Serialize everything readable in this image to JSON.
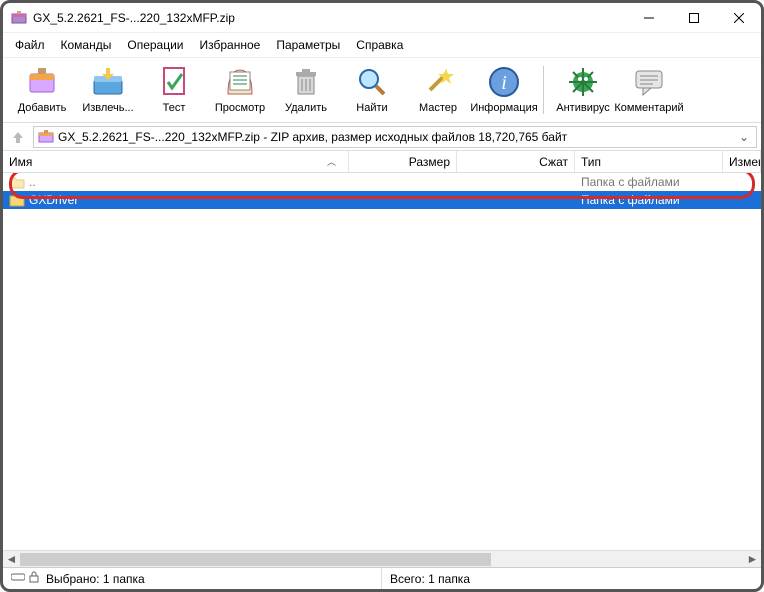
{
  "window": {
    "title": "GX_5.2.2621_FS-...220_132xMFP.zip"
  },
  "menu": {
    "file": "Файл",
    "commands": "Команды",
    "operations": "Операции",
    "favorites": "Избранное",
    "options": "Параметры",
    "help": "Справка"
  },
  "toolbar": {
    "add": "Добавить",
    "extract": "Извлечь...",
    "test": "Тест",
    "view": "Просмотр",
    "delete": "Удалить",
    "find": "Найти",
    "wizard": "Мастер",
    "info": "Информация",
    "antivirus": "Антивирус",
    "comment": "Комментарий"
  },
  "address": {
    "text": "GX_5.2.2621_FS-...220_132xMFP.zip - ZIP архив, размер исходных файлов 18,720,765 байт"
  },
  "columns": {
    "name": "Имя",
    "size": "Размер",
    "packed": "Сжат",
    "type": "Тип",
    "modified": "Измен"
  },
  "rows": {
    "parent": {
      "name": "..",
      "type": "Папка с файлами"
    },
    "selected": {
      "name": "GXDriver",
      "type": "Папка с файлами"
    }
  },
  "status": {
    "left": "Выбрано: 1 папка",
    "right": "Всего: 1 папка"
  },
  "icons": {
    "app": "winrar-icon"
  }
}
